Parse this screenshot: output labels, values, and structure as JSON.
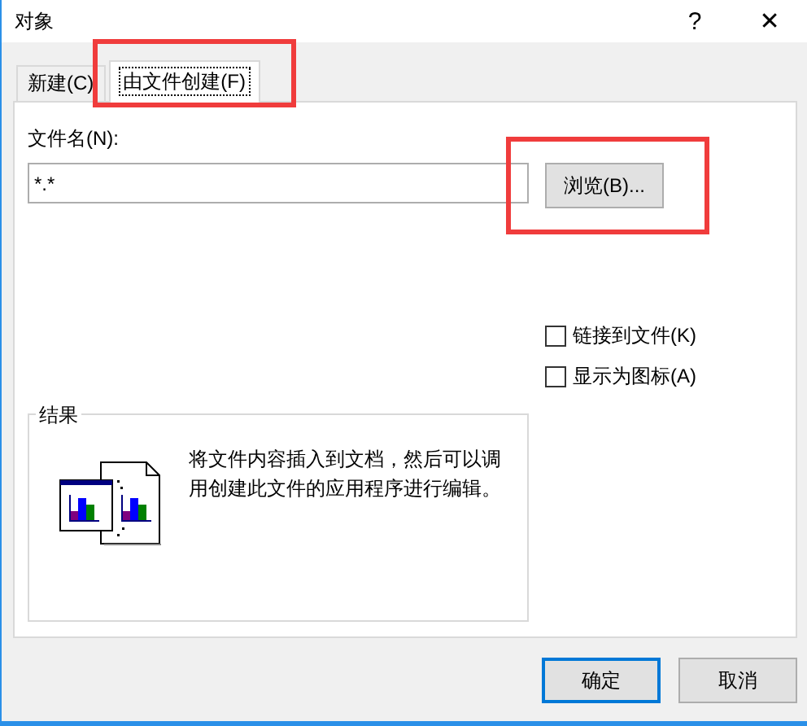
{
  "window": {
    "title": "对象",
    "help": "?",
    "close": "✕"
  },
  "tabs": [
    {
      "label": "新建(C)",
      "selected": false,
      "highlighted": false
    },
    {
      "label": "由文件创建(F)",
      "selected": true,
      "highlighted": true
    }
  ],
  "file_name": {
    "label": "文件名(N):",
    "value": "*.*"
  },
  "browse_button": {
    "label": "浏览(B)...",
    "highlighted": true
  },
  "options": [
    {
      "label": "链接到文件(K)",
      "checked": false
    },
    {
      "label": "显示为图标(A)",
      "checked": false
    }
  ],
  "result": {
    "title": "结果",
    "text": "将文件内容插入到文档，然后可以调用创建此文件的应用程序进行编辑。"
  },
  "buttons": [
    {
      "label": "确定",
      "default": true
    },
    {
      "label": "取消",
      "default": false
    }
  ]
}
